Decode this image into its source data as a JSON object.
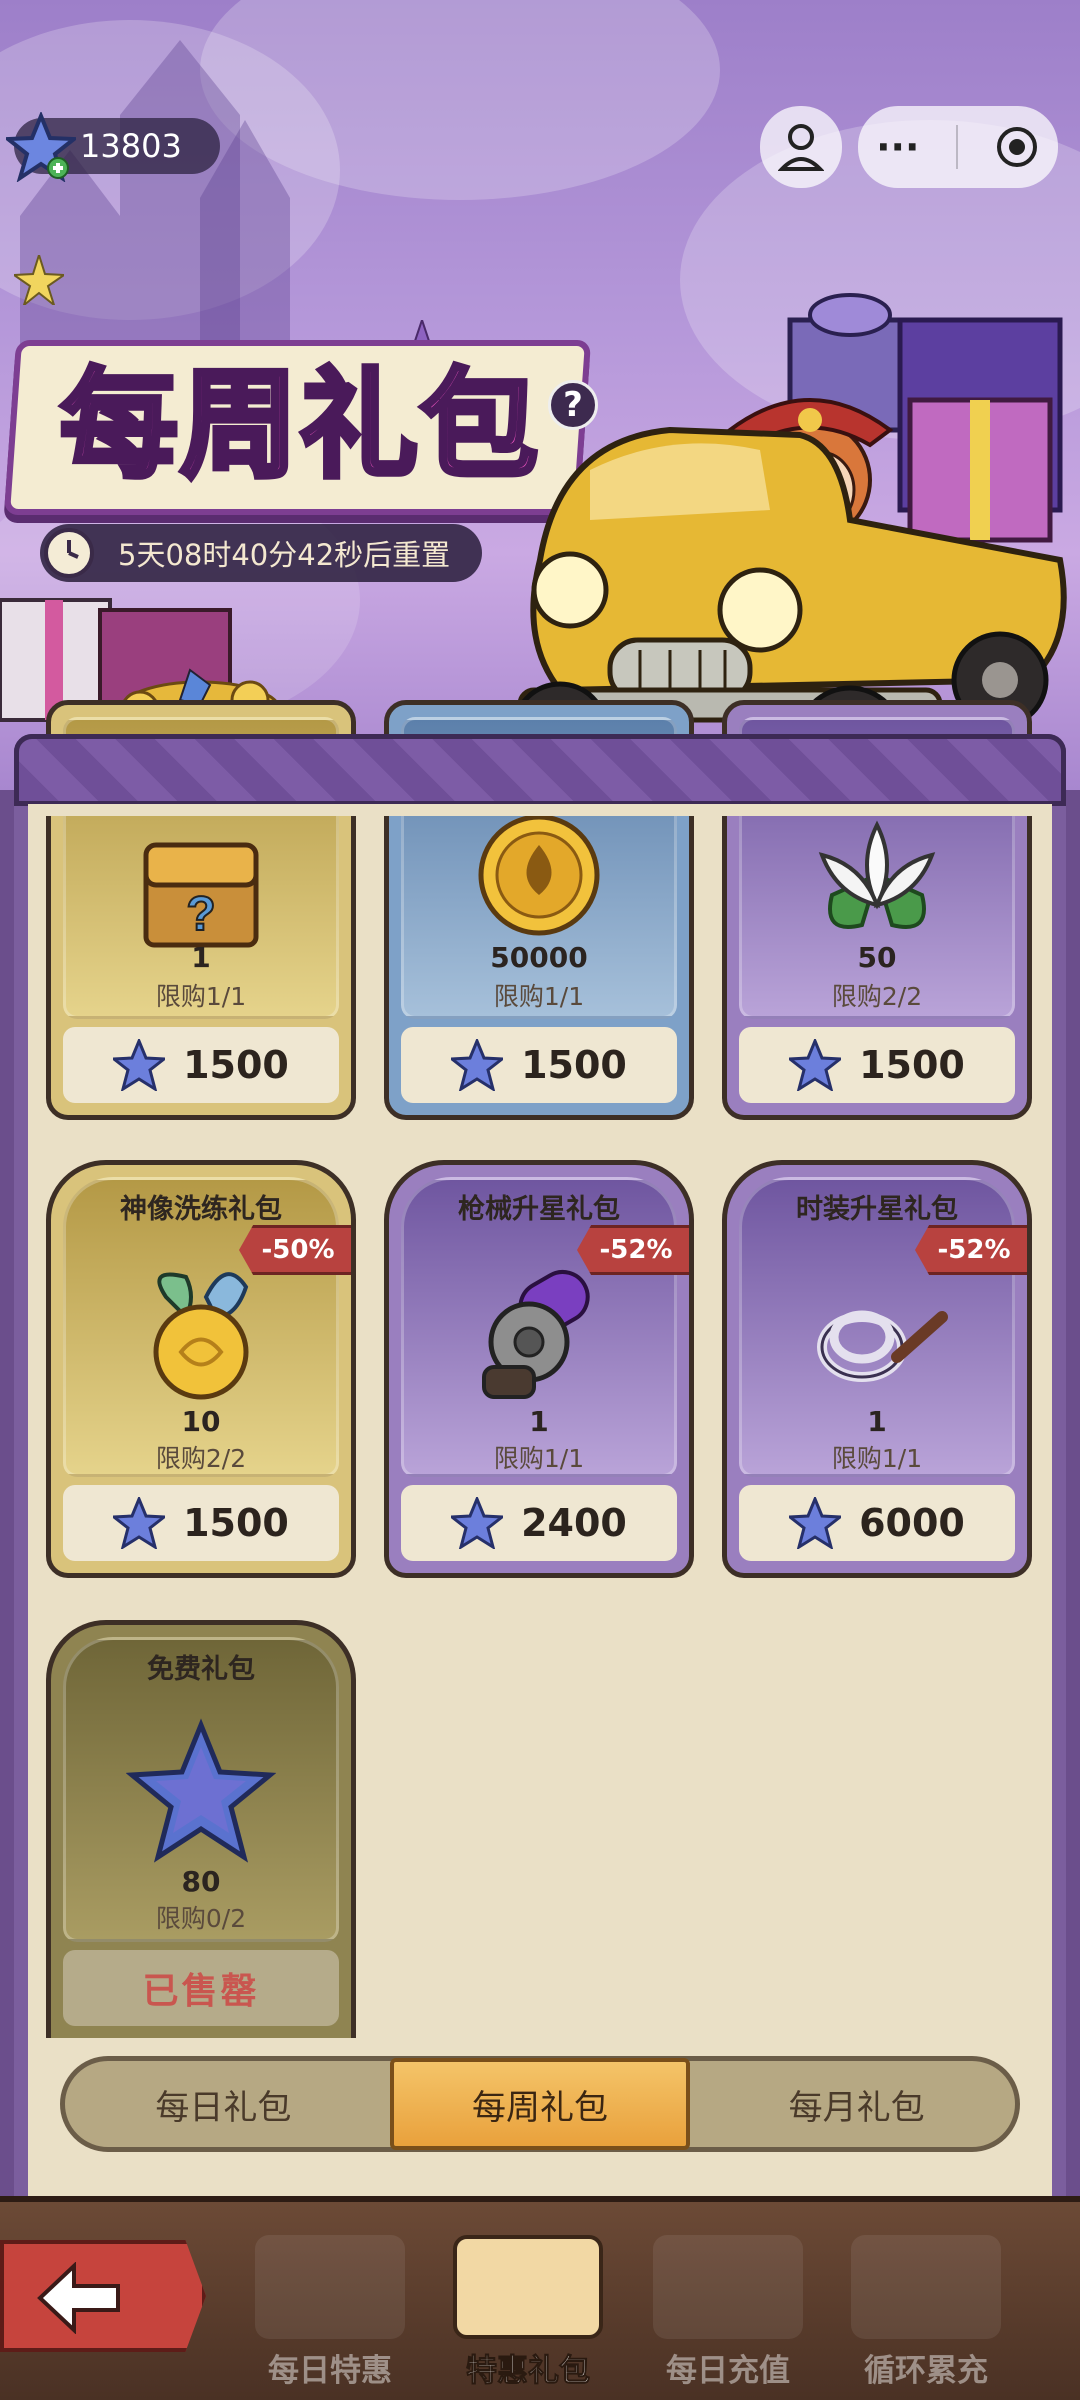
{
  "header": {
    "currency_amount": "13803",
    "title": "每周礼包",
    "help_label": "?",
    "reset_timer": "5天08时40分42秒后重置"
  },
  "top_controls": {
    "more_label": "···"
  },
  "cards": [
    {
      "title": "",
      "qty": "1",
      "limit": "限购1/1",
      "price": "1500",
      "icon": "treasure-chest-icon",
      "theme": "gold"
    },
    {
      "title": "",
      "qty": "50000",
      "limit": "限购1/1",
      "price": "1500",
      "icon": "gold-coin-icon",
      "theme": "blue"
    },
    {
      "title": "",
      "qty": "50",
      "limit": "限购2/2",
      "price": "1500",
      "icon": "lily-flower-icon",
      "theme": "purple"
    },
    {
      "title": "神像洗练礼包",
      "discount": "-50%",
      "qty": "10",
      "limit": "限购2/2",
      "price": "1500",
      "icon": "golden-fruit-icon",
      "theme": "gold"
    },
    {
      "title": "枪械升星礼包",
      "discount": "-52%",
      "qty": "1",
      "limit": "限购1/1",
      "price": "2400",
      "icon": "gear-gun-part-icon",
      "theme": "purple"
    },
    {
      "title": "时装升星礼包",
      "discount": "-52%",
      "qty": "1",
      "limit": "限购1/1",
      "price": "6000",
      "icon": "rope-whip-icon",
      "theme": "purple"
    },
    {
      "title": "免费礼包",
      "qty": "80",
      "limit": "限购0/2",
      "soldout": "已售罄",
      "icon": "blue-star-icon",
      "theme": "olive"
    }
  ],
  "tabs": [
    {
      "label": "每日礼包",
      "active": false
    },
    {
      "label": "每周礼包",
      "active": true
    },
    {
      "label": "每月礼包",
      "active": false
    }
  ],
  "bottom_nav": [
    {
      "label": "每日特惠",
      "active": false
    },
    {
      "label": "特惠礼包",
      "active": true
    },
    {
      "label": "每日充值",
      "active": false
    },
    {
      "label": "循环累充",
      "active": false
    }
  ],
  "colors": {
    "accent_pink": "#e24fb9",
    "discount_red": "#b8423f",
    "tab_active": "#e9a13c",
    "star_blue": "#5a6fd0"
  }
}
